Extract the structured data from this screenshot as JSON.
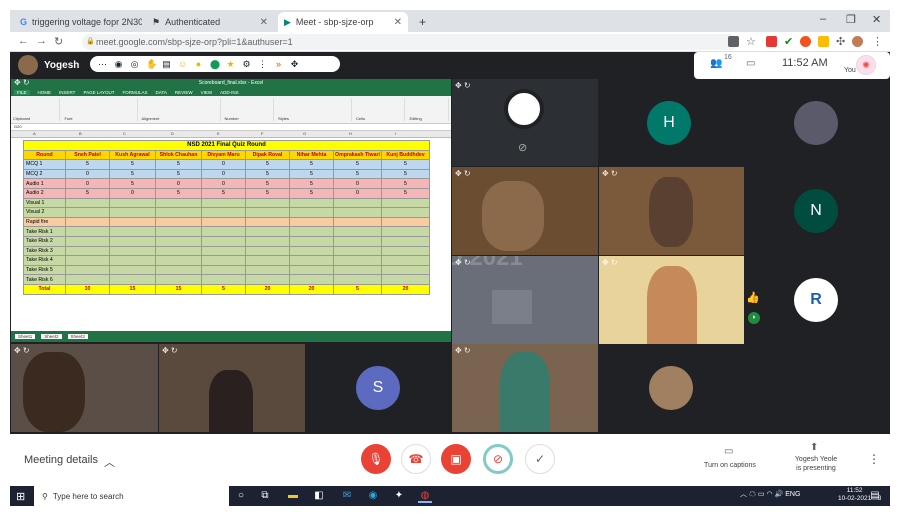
{
  "browser": {
    "tabs": [
      {
        "title": "triggering voltage fopr 2N3055 t"
      },
      {
        "title": "Authenticated"
      },
      {
        "title": "Meet - sbp-sjze-orp"
      }
    ],
    "new_tab": "+",
    "window_controls": [
      "–",
      "❐",
      "✕"
    ],
    "url": "meet.google.com/sbp-sjze-orp?pli=1&authuser=1"
  },
  "meet": {
    "presenter_name": "Yogesh",
    "time": "11:52 AM",
    "people_count": "16",
    "you_label": "You",
    "excel": {
      "window_title": "Scoreboard_final.xlsx - Excel",
      "menu": [
        "FILE",
        "HOME",
        "INSERT",
        "PAGE LAYOUT",
        "FORMULAS",
        "DATA",
        "REVIEW",
        "VIEW",
        "ADD-INS"
      ],
      "ribbon_groups": [
        "Clipboard",
        "Font",
        "Alignment",
        "Number",
        "Styles",
        "Cells",
        "Editing"
      ],
      "name_box": "G20",
      "columns": [
        "A",
        "B",
        "C",
        "D",
        "E",
        "F",
        "G",
        "H",
        "I",
        "J",
        "K"
      ],
      "sheet_title": "NSD 2021 Final Quiz Round",
      "header": [
        "Round",
        "Sneh Patel",
        "Kush Agrawal",
        "Shlok Chauhan",
        "Divyam Maru",
        "Dipak Roval",
        "Nihar Mehta",
        "Omprakash Tiwari",
        "Kunj Buddhdev"
      ],
      "rows": [
        {
          "num": "1",
          "label": "MCQ 1",
          "cells": [
            "5",
            "5",
            "5",
            "0",
            "5",
            "5",
            "5",
            "5"
          ],
          "color": "#bdd7ee"
        },
        {
          "num": "",
          "label": "MCQ 2",
          "cells": [
            "0",
            "5",
            "5",
            "0",
            "5",
            "5",
            "5",
            "5"
          ],
          "color": "#bdd7ee"
        },
        {
          "num": "2",
          "label": "Audio 1",
          "cells": [
            "0",
            "5",
            "0",
            "0",
            "5",
            "5",
            "0",
            "5"
          ],
          "color": "#f4b6b6"
        },
        {
          "num": "",
          "label": "Audio 2",
          "cells": [
            "5",
            "0",
            "5",
            "5",
            "5",
            "5",
            "0",
            "5"
          ],
          "color": "#f4b6b6"
        },
        {
          "num": "3",
          "label": "Visual 1",
          "cells": [
            "",
            "",
            "",
            "",
            "",
            "",
            "",
            ""
          ],
          "color": "#c6d8a4"
        },
        {
          "num": "",
          "label": "Visual 2",
          "cells": [
            "",
            "",
            "",
            "",
            "",
            "",
            "",
            ""
          ],
          "color": "#c6d8a4"
        },
        {
          "num": "4",
          "label": "Rapid fire",
          "cells": [
            "",
            "",
            "",
            "",
            "",
            "",
            "",
            ""
          ],
          "color": "#f8cba0"
        },
        {
          "num": "",
          "label": "Take  Risk 1",
          "cells": [
            "",
            "",
            "",
            "",
            "",
            "",
            "",
            ""
          ],
          "color": "#c6d8a4"
        },
        {
          "num": "",
          "label": "Take  Risk 2",
          "cells": [
            "",
            "",
            "",
            "",
            "",
            "",
            "",
            ""
          ],
          "color": "#c6d8a4"
        },
        {
          "num": "5",
          "label": "Take  Risk 3",
          "cells": [
            "",
            "",
            "",
            "",
            "",
            "",
            "",
            ""
          ],
          "color": "#c6d8a4"
        },
        {
          "num": "",
          "label": "Take  Risk 4",
          "cells": [
            "",
            "",
            "",
            "",
            "",
            "",
            "",
            ""
          ],
          "color": "#c6d8a4"
        },
        {
          "num": "",
          "label": "Take  Risk 5",
          "cells": [
            "",
            "",
            "",
            "",
            "",
            "",
            "",
            ""
          ],
          "color": "#c6d8a4"
        },
        {
          "num": "",
          "label": "Take  Risk 6",
          "cells": [
            "",
            "",
            "",
            "",
            "",
            "",
            "",
            ""
          ],
          "color": "#c6d8a4"
        }
      ],
      "total_label": "Total",
      "totals": [
        "10",
        "15",
        "15",
        "5",
        "20",
        "20",
        "5",
        "20"
      ],
      "sheet_tabs": [
        "Sheet1",
        "Sheet2",
        "Sheet3"
      ]
    },
    "avatar_letters": {
      "h": "H",
      "n": "N",
      "s": "S"
    },
    "watermark": "NSD 2021"
  },
  "controls": {
    "meeting_details": "Meeting details",
    "captions": "Turn on captions",
    "presenting_name": "Yogesh Yeole",
    "presenting_suffix": "is presenting"
  },
  "taskbar": {
    "search_placeholder": "Type here to search",
    "lang": "ENG",
    "time": "11:52",
    "date": "10-02-2021",
    "notif_count": "3"
  },
  "colors": {
    "meet_bg": "#202124",
    "tile_bg": "#3c4043",
    "end_call": "#ea4335",
    "avatar_h": "#00796b",
    "avatar_n": "#004d40",
    "avatar_s": "#5c6bc0",
    "excel_green": "#217346"
  }
}
